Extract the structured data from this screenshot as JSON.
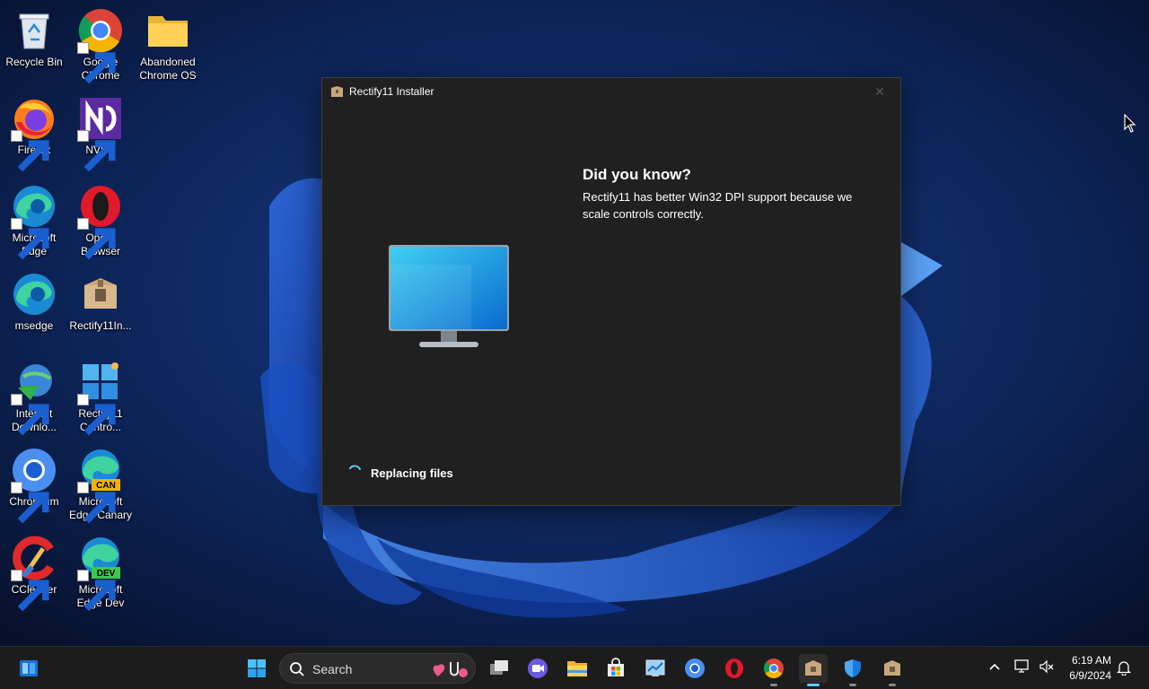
{
  "desktop": {
    "icons": [
      {
        "label": "Recycle Bin",
        "icon": "recycle-bin-icon"
      },
      {
        "label": "Google Chrome",
        "icon": "chrome-icon"
      },
      {
        "label": "Abandoned Chrome OS",
        "icon": "folder-icon"
      },
      {
        "label": "Firefox",
        "icon": "firefox-icon"
      },
      {
        "label": "NVDA",
        "icon": "nvda-icon"
      },
      {
        "label": "Microsoft Edge",
        "icon": "edge-icon"
      },
      {
        "label": "Opera Browser",
        "icon": "opera-icon"
      },
      {
        "label": "msedge",
        "icon": "edge-icon"
      },
      {
        "label": "Rectify11In...",
        "icon": "package-icon"
      },
      {
        "label": "Internet Downlo...",
        "icon": "idm-icon"
      },
      {
        "label": "Rectify11 Contro...",
        "icon": "control-center-icon"
      },
      {
        "label": "Chromium",
        "icon": "chromium-icon"
      },
      {
        "label": "Microsoft Edge Canary",
        "icon": "edge-canary-icon",
        "badge": "CAN"
      },
      {
        "label": "CCleaner",
        "icon": "ccleaner-icon"
      },
      {
        "label": "Microsoft Edge Dev",
        "icon": "edge-dev-icon",
        "badge": "DEV"
      }
    ]
  },
  "installer": {
    "title": "Rectify11 Installer",
    "close_glyph": "✕",
    "tip_heading": "Did you know?",
    "tip_body": "Rectify11 has better Win32 DPI support because we scale controls correctly.",
    "status": "Replacing files"
  },
  "taskbar": {
    "search_label": "Search",
    "apps": [
      "start-icon",
      "search",
      "task-view-icon",
      "meet-icon",
      "file-explorer-icon",
      "store-icon",
      "control-panel-icon",
      "chromium-icon",
      "opera-icon",
      "chrome-icon",
      "installer-icon",
      "defender-icon",
      "package-icon"
    ],
    "clock_time": "6:19 AM",
    "clock_date": "6/9/2024"
  },
  "colors": {
    "window_bg": "#202020",
    "accent": "#60cdff",
    "taskbar_bg": "#1c1c1c"
  }
}
